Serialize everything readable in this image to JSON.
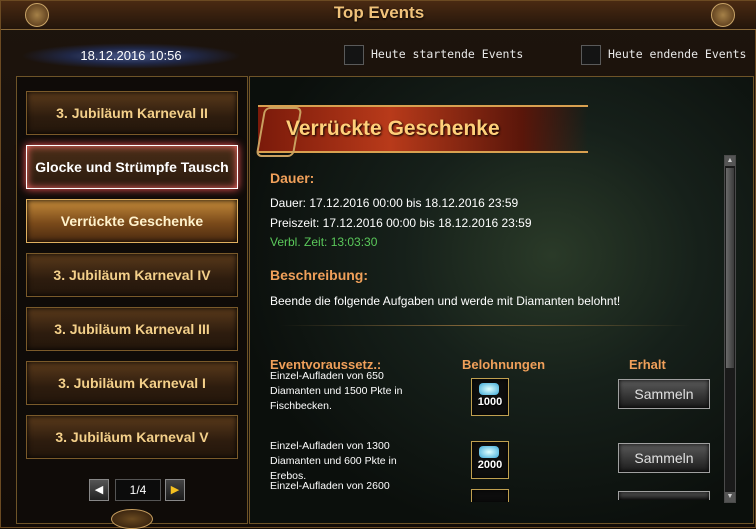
{
  "window": {
    "title": "Top Events"
  },
  "toolbar": {
    "datetime": "18.12.2016 10:56",
    "filter_starting": "Heute startende Events",
    "filter_ending": "Heute endende Events"
  },
  "nav": {
    "items": [
      {
        "label": "3. Jubiläum Karneval II",
        "state": "normal"
      },
      {
        "label": "Glocke und Strümpfe Tausch",
        "state": "hover"
      },
      {
        "label": "Verrückte Geschenke",
        "state": "active"
      },
      {
        "label": "3. Jubiläum Karneval IV",
        "state": "normal"
      },
      {
        "label": "3. Jubiläum Karneval III",
        "state": "normal"
      },
      {
        "label": "3. Jubiläum Karneval I",
        "state": "normal"
      },
      {
        "label": "3. Jubiläum Karneval V",
        "state": "normal"
      }
    ],
    "page": "1/4"
  },
  "event": {
    "title": "Verrückte Geschenke",
    "duration_heading": "Dauer:",
    "duration": "Dauer: 17.12.2016 00:00 bis 18.12.2016 23:59",
    "reward_period": "Preiszeit: 17.12.2016 00:00 bis 18.12.2016 23:59",
    "remaining": "Verbl. Zeit: 13:03:30",
    "description_heading": "Beschreibung:",
    "description": "Beende die folgende Aufgaben und werde mit Diamanten belohnt!",
    "columns": {
      "requirement": "Eventvoraussetz.:",
      "rewards": "Belohnungen",
      "obtained": "Erhalt"
    },
    "tasks": [
      {
        "requirement": "Einzel-Aufladen von 650 Diamanten und 1500 Pkte in Fischbecken.",
        "reward": "1000",
        "button": "Sammeln"
      },
      {
        "requirement": "Einzel-Aufladen von 1300 Diamanten und 600 Pkte in Erebos.",
        "reward": "2000",
        "button": "Sammeln"
      },
      {
        "requirement": "Einzel-Aufladen von 2600",
        "reward": "",
        "button": ""
      }
    ]
  },
  "colors": {
    "accent": "#f0a05a",
    "gold": "#f4d08a",
    "remaining": "#5ac85a"
  }
}
